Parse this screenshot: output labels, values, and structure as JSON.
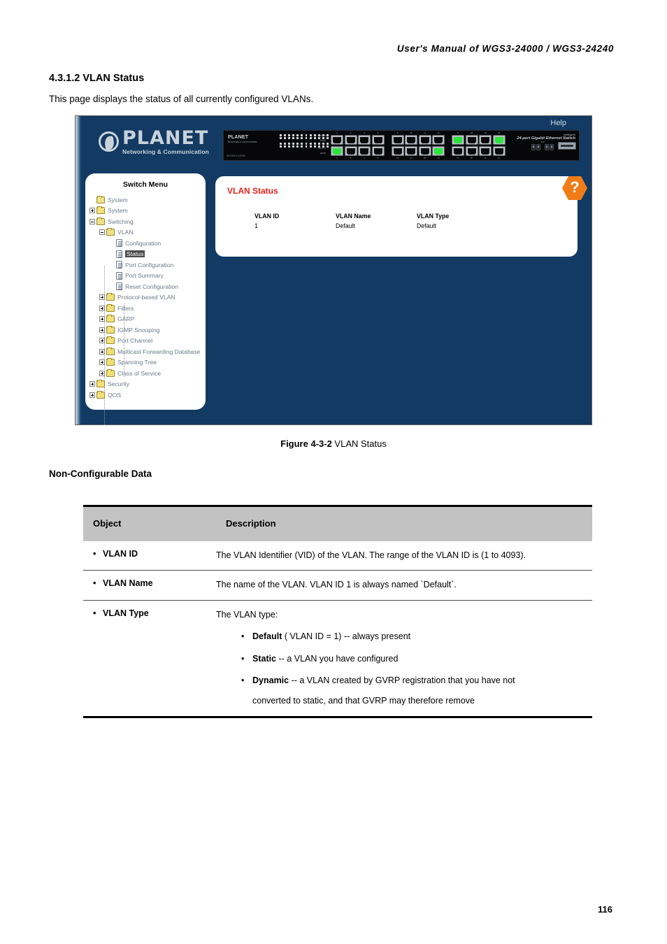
{
  "document": {
    "header": "User's  Manual  of  WGS3-24000  /  WGS3-24240",
    "section_number_title": "4.3.1.2 VLAN Status",
    "intro": "This page displays the status of all currently configured VLANs.",
    "figure_caption_bold": "Figure 4-3-2",
    "figure_caption_text": " VLAN Status",
    "non_configurable_title": "Non-Configurable Data",
    "page_number": "116"
  },
  "screenshot": {
    "help_link": "Help",
    "logo": {
      "name": "PLANET",
      "tagline": "Networking & Communication"
    },
    "device": {
      "brand": "PLANET",
      "brand_sub": "Networking & Communication",
      "model": "WGSW3-24000",
      "title_top": "Intelligent",
      "title_main": "24-port Gigabit Ethernet Switch",
      "segment_label": "SFP",
      "segments": [
        "0",
        "0",
        "0",
        "0"
      ],
      "led_labels_top": [
        "1",
        "2",
        "3",
        "4",
        "5",
        "6",
        "7",
        "8",
        "9",
        "10",
        "11",
        "12"
      ],
      "led_labels_bottom": [
        "13",
        "14",
        "15",
        "16",
        "17",
        "18",
        "19",
        "20",
        "21",
        "22",
        "23",
        "24"
      ],
      "led_group_top": "LINK/ACT",
      "led_group_top2": "1000M",
      "led_group_bottom": "LINK/ACT",
      "led_group_bottom2": "1000M",
      "port_numbers_top": [
        "1",
        "2",
        "3",
        "4",
        "9",
        "10",
        "11",
        "12",
        "17",
        "18",
        "19",
        "20"
      ],
      "port_numbers_bottom": [
        "5",
        "6",
        "7",
        "8",
        "13",
        "14",
        "15",
        "16",
        "21",
        "22",
        "23",
        "24"
      ]
    },
    "menu": {
      "title": "Switch Menu",
      "items": [
        {
          "label": "System",
          "indent": 1,
          "icon": "folder-open-icon",
          "expander": "none",
          "italic": true,
          "selected": false
        },
        {
          "label": "System",
          "indent": 1,
          "icon": "folder-icon",
          "expander": "plus",
          "italic": false,
          "selected": false
        },
        {
          "label": "Switching",
          "indent": 1,
          "icon": "folder-open-icon",
          "expander": "minus",
          "italic": false,
          "selected": false
        },
        {
          "label": "VLAN",
          "indent": 2,
          "icon": "folder-open-icon",
          "expander": "minus",
          "italic": false,
          "selected": false
        },
        {
          "label": "Configuration",
          "indent": 3,
          "icon": "page-icon",
          "expander": "none",
          "italic": false,
          "selected": false
        },
        {
          "label": "Status",
          "indent": 3,
          "icon": "page-icon",
          "expander": "none",
          "italic": false,
          "selected": true
        },
        {
          "label": "Port Configuration",
          "indent": 3,
          "icon": "page-icon",
          "expander": "none",
          "italic": false,
          "selected": false
        },
        {
          "label": "Port Summary",
          "indent": 3,
          "icon": "page-icon",
          "expander": "none",
          "italic": false,
          "selected": false
        },
        {
          "label": "Reset Configuration",
          "indent": 3,
          "icon": "page-icon",
          "expander": "none",
          "italic": false,
          "selected": false
        },
        {
          "label": "Protocol-based VLAN",
          "indent": 2,
          "icon": "folder-icon",
          "expander": "plus",
          "italic": false,
          "selected": false
        },
        {
          "label": "Filters",
          "indent": 2,
          "icon": "folder-icon",
          "expander": "plus",
          "italic": false,
          "selected": false
        },
        {
          "label": "GARP",
          "indent": 2,
          "icon": "folder-icon",
          "expander": "plus",
          "italic": false,
          "selected": false
        },
        {
          "label": "IGMP Snooping",
          "indent": 2,
          "icon": "folder-icon",
          "expander": "plus",
          "italic": false,
          "selected": false
        },
        {
          "label": "Port Channel",
          "indent": 2,
          "icon": "folder-icon",
          "expander": "plus",
          "italic": false,
          "selected": false
        },
        {
          "label": "Multicast Forwarding Database",
          "indent": 2,
          "icon": "folder-icon",
          "expander": "plus",
          "italic": false,
          "selected": false
        },
        {
          "label": "Spanning Tree",
          "indent": 2,
          "icon": "folder-icon",
          "expander": "plus",
          "italic": false,
          "selected": false
        },
        {
          "label": "Class of Service",
          "indent": 2,
          "icon": "folder-icon",
          "expander": "plus",
          "italic": false,
          "selected": false
        },
        {
          "label": "Security",
          "indent": 1,
          "icon": "folder-icon",
          "expander": "plus",
          "italic": false,
          "selected": false
        },
        {
          "label": "QOS",
          "indent": 1,
          "icon": "folder-icon",
          "expander": "plus",
          "italic": false,
          "selected": false
        }
      ]
    },
    "panel": {
      "title": "VLAN Status",
      "help_badge": "?",
      "columns": [
        "VLAN ID",
        "VLAN Name",
        "VLAN Type"
      ],
      "rows": [
        [
          "1",
          "Default",
          "Default"
        ]
      ]
    },
    "colors": {
      "background": "#123a63",
      "panel_title": "#e8211a",
      "help_badge": "#f07c18"
    }
  },
  "desc_table": {
    "headers": {
      "object": "Object",
      "description": "Description"
    },
    "rows": [
      {
        "object": "VLAN ID",
        "description": "The VLAN Identifier (VID) of the VLAN. The range of the VLAN ID is (1 to 4093)."
      },
      {
        "object": "VLAN Name",
        "description": "The name of the VLAN. VLAN ID 1 is always named `Default`."
      },
      {
        "object": "VLAN Type",
        "description": "The VLAN type:",
        "sub_items": [
          {
            "bold": "Default",
            "rest": " ( VLAN ID = 1) -- always present"
          },
          {
            "bold": "Static",
            "rest": " -- a VLAN you have configured"
          },
          {
            "bold": "Dynamic",
            "rest": " -- a VLAN created by GVRP registration that you have not"
          }
        ],
        "continuation": "converted to static, and that GVRP may therefore remove"
      }
    ]
  }
}
